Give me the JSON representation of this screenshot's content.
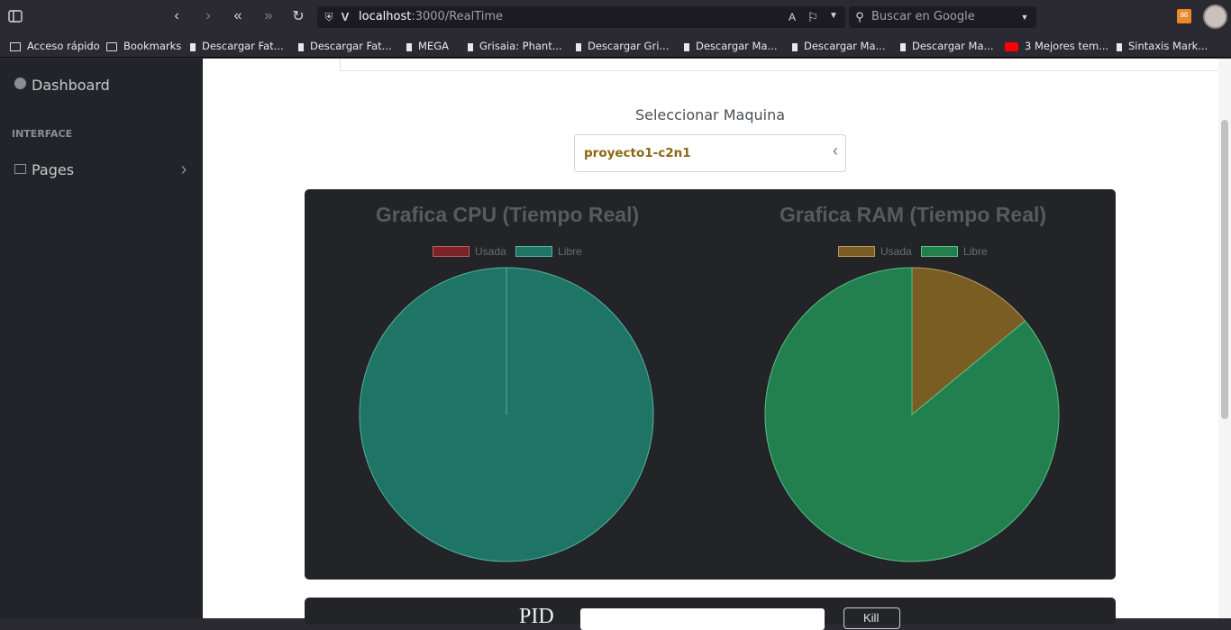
{
  "browser": {
    "url_host": "localhost",
    "url_path": ":3000/RealTime",
    "search_placeholder": "Buscar en Google",
    "bookmarks": [
      "Acceso rápido",
      "Bookmarks",
      "Descargar Fat...",
      "Descargar Fat...",
      "MEGA",
      "Grisaia: Phant...",
      "Descargar Gri...",
      "Descargar Ma...",
      "Descargar Ma...",
      "Descargar Ma...",
      "3 Mejores tem...",
      "Sintaxis Mark..."
    ]
  },
  "sidebar": {
    "dashboard": "Dashboard",
    "heading": "INTERFACE",
    "pages": "Pages"
  },
  "main": {
    "select_label": "Seleccionar Maquina",
    "selected_machine": "proyecto1-c2n1",
    "pid_label": "PID",
    "kill_label": "Kill"
  },
  "chart_data": [
    {
      "type": "pie",
      "title": "Grafica CPU (Tiempo Real)",
      "categories": [
        "Usada",
        "Libre"
      ],
      "values": [
        0,
        100
      ],
      "colors": [
        "#7b2227",
        "#1e7465"
      ]
    },
    {
      "type": "pie",
      "title": "Grafica RAM (Tiempo Real)",
      "categories": [
        "Usada",
        "Libre"
      ],
      "values": [
        14,
        86
      ],
      "colors": [
        "#7a5d22",
        "#21804d"
      ]
    }
  ]
}
